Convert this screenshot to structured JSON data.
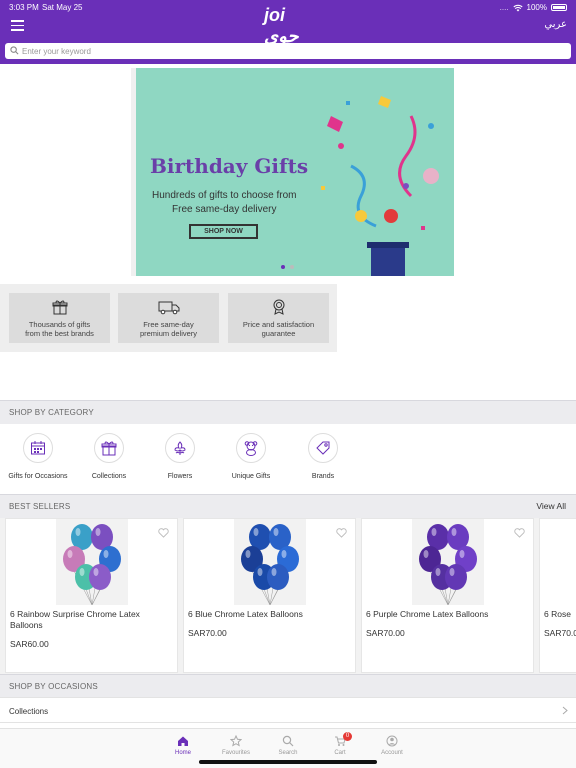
{
  "status_bar": {
    "time": "3:03 PM",
    "date": "Sat May 25",
    "signal": "....",
    "battery": "100%"
  },
  "header": {
    "logo": "joi جوي",
    "language_toggle": "عربي"
  },
  "search": {
    "placeholder": "Enter your keyword",
    "value": ""
  },
  "banner": {
    "title": "Birthday Gifts",
    "subtitle_line1": "Hundreds of gifts to choose from",
    "subtitle_line2": "Free same-day delivery",
    "cta": "SHOP NOW",
    "slides": 2,
    "active_slide": 1
  },
  "features": [
    {
      "icon": "gift-box-icon",
      "line1": "Thousands of gifts",
      "line2": "from the best brands"
    },
    {
      "icon": "delivery-truck-icon",
      "line1": "Free same-day",
      "line2": "premium delivery"
    },
    {
      "icon": "award-badge-icon",
      "line1": "Price and satisfaction",
      "line2": "guarantee"
    }
  ],
  "shop_by_category": {
    "title": "SHOP BY CATEGORY",
    "items": [
      {
        "label": "Gifts for Occasions",
        "icon": "calendar-icon"
      },
      {
        "label": "Collections",
        "icon": "gift-icon"
      },
      {
        "label": "Flowers",
        "icon": "flower-icon"
      },
      {
        "label": "Unique Gifts",
        "icon": "teddy-bear-icon"
      },
      {
        "label": "Brands",
        "icon": "tag-icon"
      }
    ]
  },
  "best_sellers": {
    "title": "BEST SELLERS",
    "view_all": "View All",
    "products": [
      {
        "name": "6 Rainbow Surprise Chrome Latex Balloons",
        "price": "SAR60.00",
        "colors": [
          "#3aa0c8",
          "#7b4fc0",
          "#c77bb8",
          "#2e6fd0",
          "#4cc0a8",
          "#8b5cc8"
        ]
      },
      {
        "name": "6 Blue Chrome Latex Balloons",
        "price": "SAR70.00",
        "colors": [
          "#1f4fb0",
          "#2a62c8",
          "#1b3f96",
          "#2b6bd6",
          "#1a4aa8",
          "#2c5cc0"
        ]
      },
      {
        "name": "6 Purple Chrome Latex Balloons",
        "price": "SAR70.00",
        "colors": [
          "#5a2fa8",
          "#6a3cc0",
          "#4d2694",
          "#7040c8",
          "#5530a0",
          "#6238b4"
        ]
      },
      {
        "name": "6 Rose",
        "price": "SAR70.0"
      }
    ]
  },
  "shop_by_occasions": {
    "title": "SHOP BY OCCASIONS",
    "rows": [
      {
        "label": "Collections"
      }
    ]
  },
  "tab_bar": {
    "tabs": [
      {
        "label": "Home",
        "icon": "home-icon",
        "active": true
      },
      {
        "label": "Favourites",
        "icon": "star-icon",
        "active": false
      },
      {
        "label": "Search",
        "icon": "search-icon",
        "active": false
      },
      {
        "label": "Cart",
        "icon": "cart-icon",
        "active": false,
        "badge": "0"
      },
      {
        "label": "Account",
        "icon": "account-icon",
        "active": false
      }
    ]
  },
  "colors": {
    "brand": "#6a2fb8",
    "banner_bg": "#8fd7c2",
    "badge": "#e53935"
  }
}
